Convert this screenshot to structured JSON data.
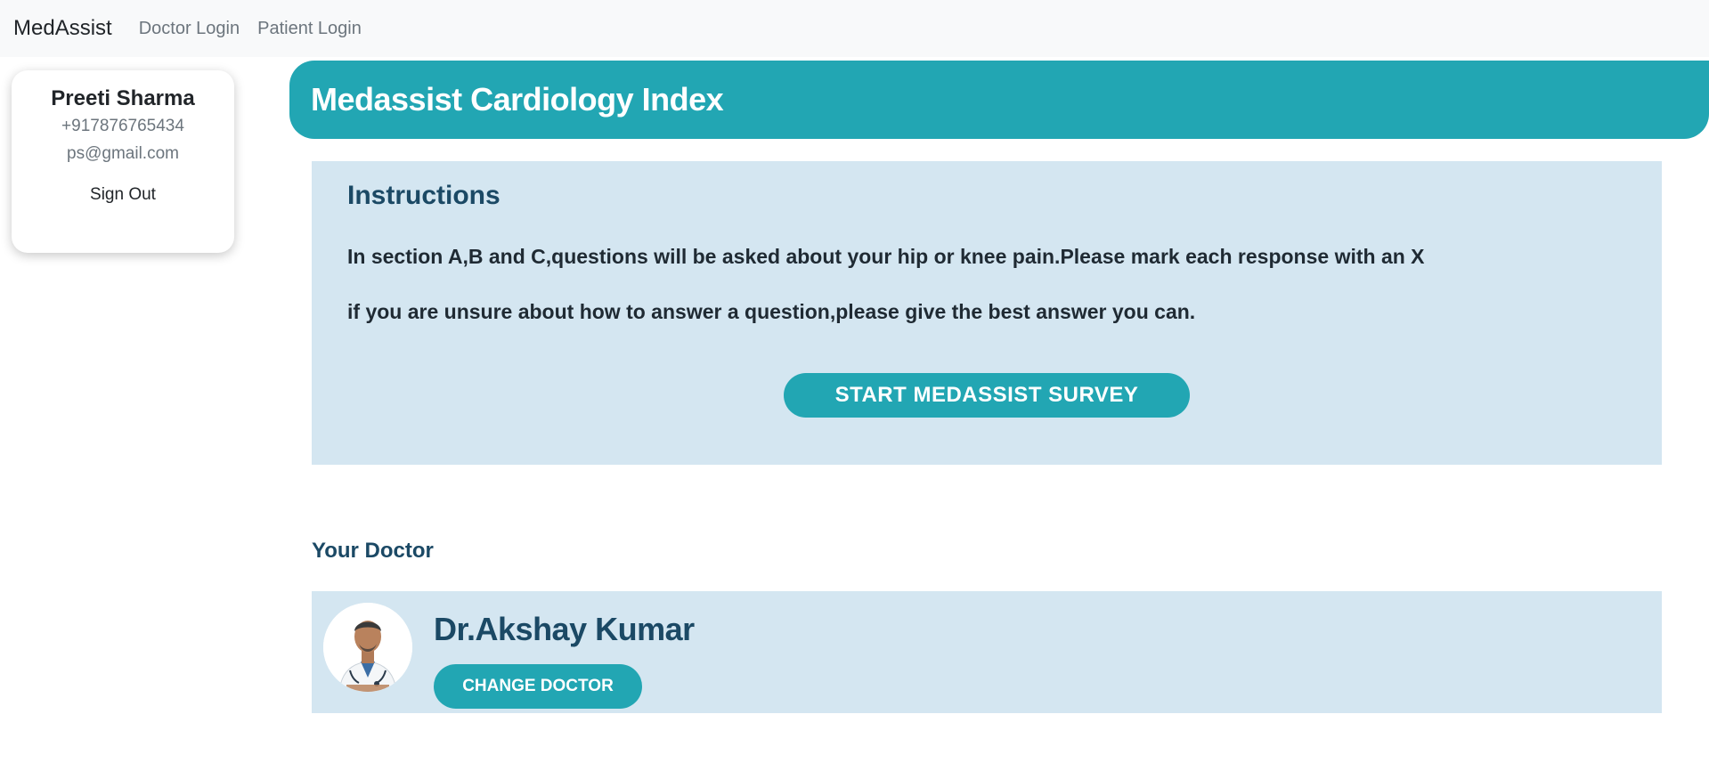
{
  "navbar": {
    "brand": "MedAssist",
    "links": [
      "Doctor Login",
      "Patient Login"
    ]
  },
  "profile": {
    "name": "Preeti Sharma",
    "phone": "+917876765434",
    "email": "ps@gmail.com",
    "signout_label": "Sign Out"
  },
  "banner": {
    "title": "Medassist Cardiology Index"
  },
  "instructions": {
    "heading": "Instructions",
    "line1": "In section A,B and C,questions will be asked about your hip or knee pain.Please mark each response with an X",
    "line2": "if you are unsure about how to answer a question,please give the best answer you can.",
    "start_label": "START MEDASSIST SURVEY"
  },
  "doctor": {
    "heading": "Your Doctor",
    "name": "Dr.Akshay Kumar",
    "change_label": "CHANGE DOCTOR"
  },
  "colors": {
    "accent": "#22a6b3",
    "panel": "#d4e6f1",
    "heading": "#1b4965"
  }
}
